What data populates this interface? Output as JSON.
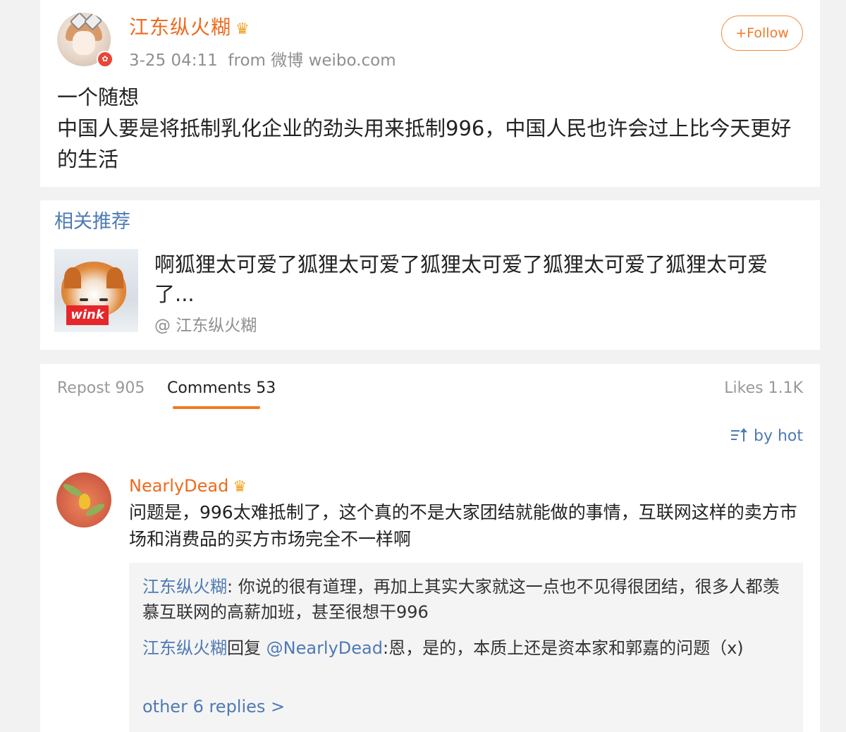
{
  "post": {
    "username": "江东纵火糊",
    "crown": "♛",
    "time": "3-25 04:11",
    "source": "from 微博 weibo.com",
    "follow_label": "+Follow",
    "text_line1": "一个随想",
    "text_line2": "中国人要是将抵制乳化企业的劲头用来抵制996，中国人民也许会过上比今天更好的生活"
  },
  "recommendations": {
    "title": "相关推荐",
    "thumb_label": "wink",
    "headline": "啊狐狸太可爱了狐狸太可爱了狐狸太可爱了狐狸太可爱了狐狸太可爱了...",
    "author": "@ 江东纵火糊"
  },
  "comments_section": {
    "tabs": {
      "repost": "Repost 905",
      "comments": "Comments 53",
      "likes": "Likes 1.1K"
    },
    "sort_label": "by hot",
    "comment": {
      "username": "NearlyDead",
      "crown": "♛",
      "text": "问题是，996太难抵制了，这个真的不是大家团结就能做的事情，互联网这样的卖方市场和消费品的买方市场完全不一样啊"
    },
    "replies": [
      {
        "author": "江东纵火糊",
        "text": ": 你说的很有道理，再加上其实大家就这一点也不见得很团结，很多人都羡慕互联网的高薪加班，甚至很想干996"
      },
      {
        "author": "江东纵火糊",
        "reply_word": "回复",
        "mention": "@NearlyDead",
        "text": ":恩，是的，本质上还是资本家和郭嘉的问题（x)"
      }
    ],
    "more_replies": "other 6 replies >"
  },
  "colors": {
    "username_orange": "#ee6a1d",
    "link_blue": "#4f7ab3",
    "tab_underline": "#f07a22"
  }
}
